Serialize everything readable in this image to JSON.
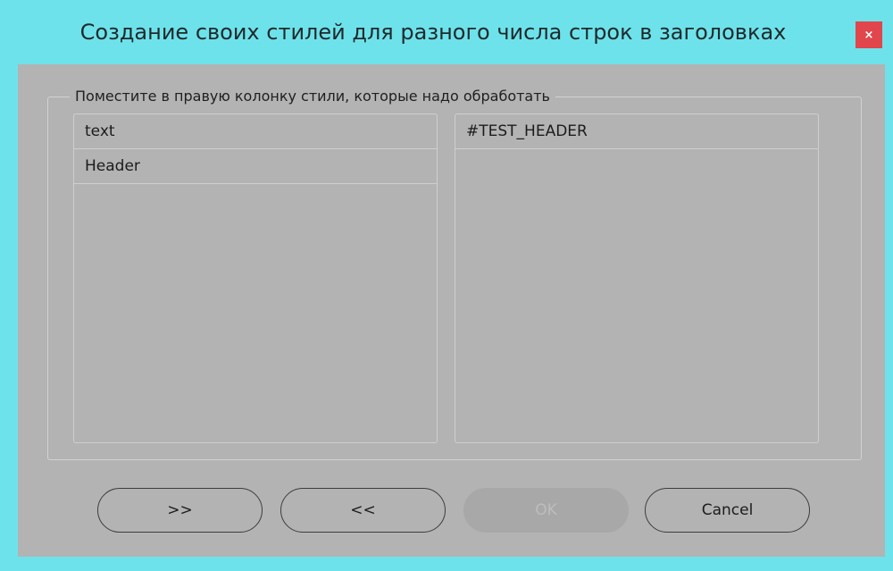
{
  "window": {
    "title": "Создание своих стилей для разного числа строк в заголовках",
    "close_label": "×"
  },
  "group": {
    "legend": "Поместите в правую колонку стили, которые надо обработать"
  },
  "left_list": {
    "items": [
      "text",
      "Header"
    ]
  },
  "right_list": {
    "items": [
      "#TEST_HEADER"
    ]
  },
  "buttons": {
    "forward_label": ">>",
    "back_label": "<<",
    "ok_label": "OK",
    "cancel_label": "Cancel"
  },
  "colors": {
    "titlebar": "#6ee2ea",
    "client": "#b3b3b3",
    "close": "#e0464c"
  }
}
